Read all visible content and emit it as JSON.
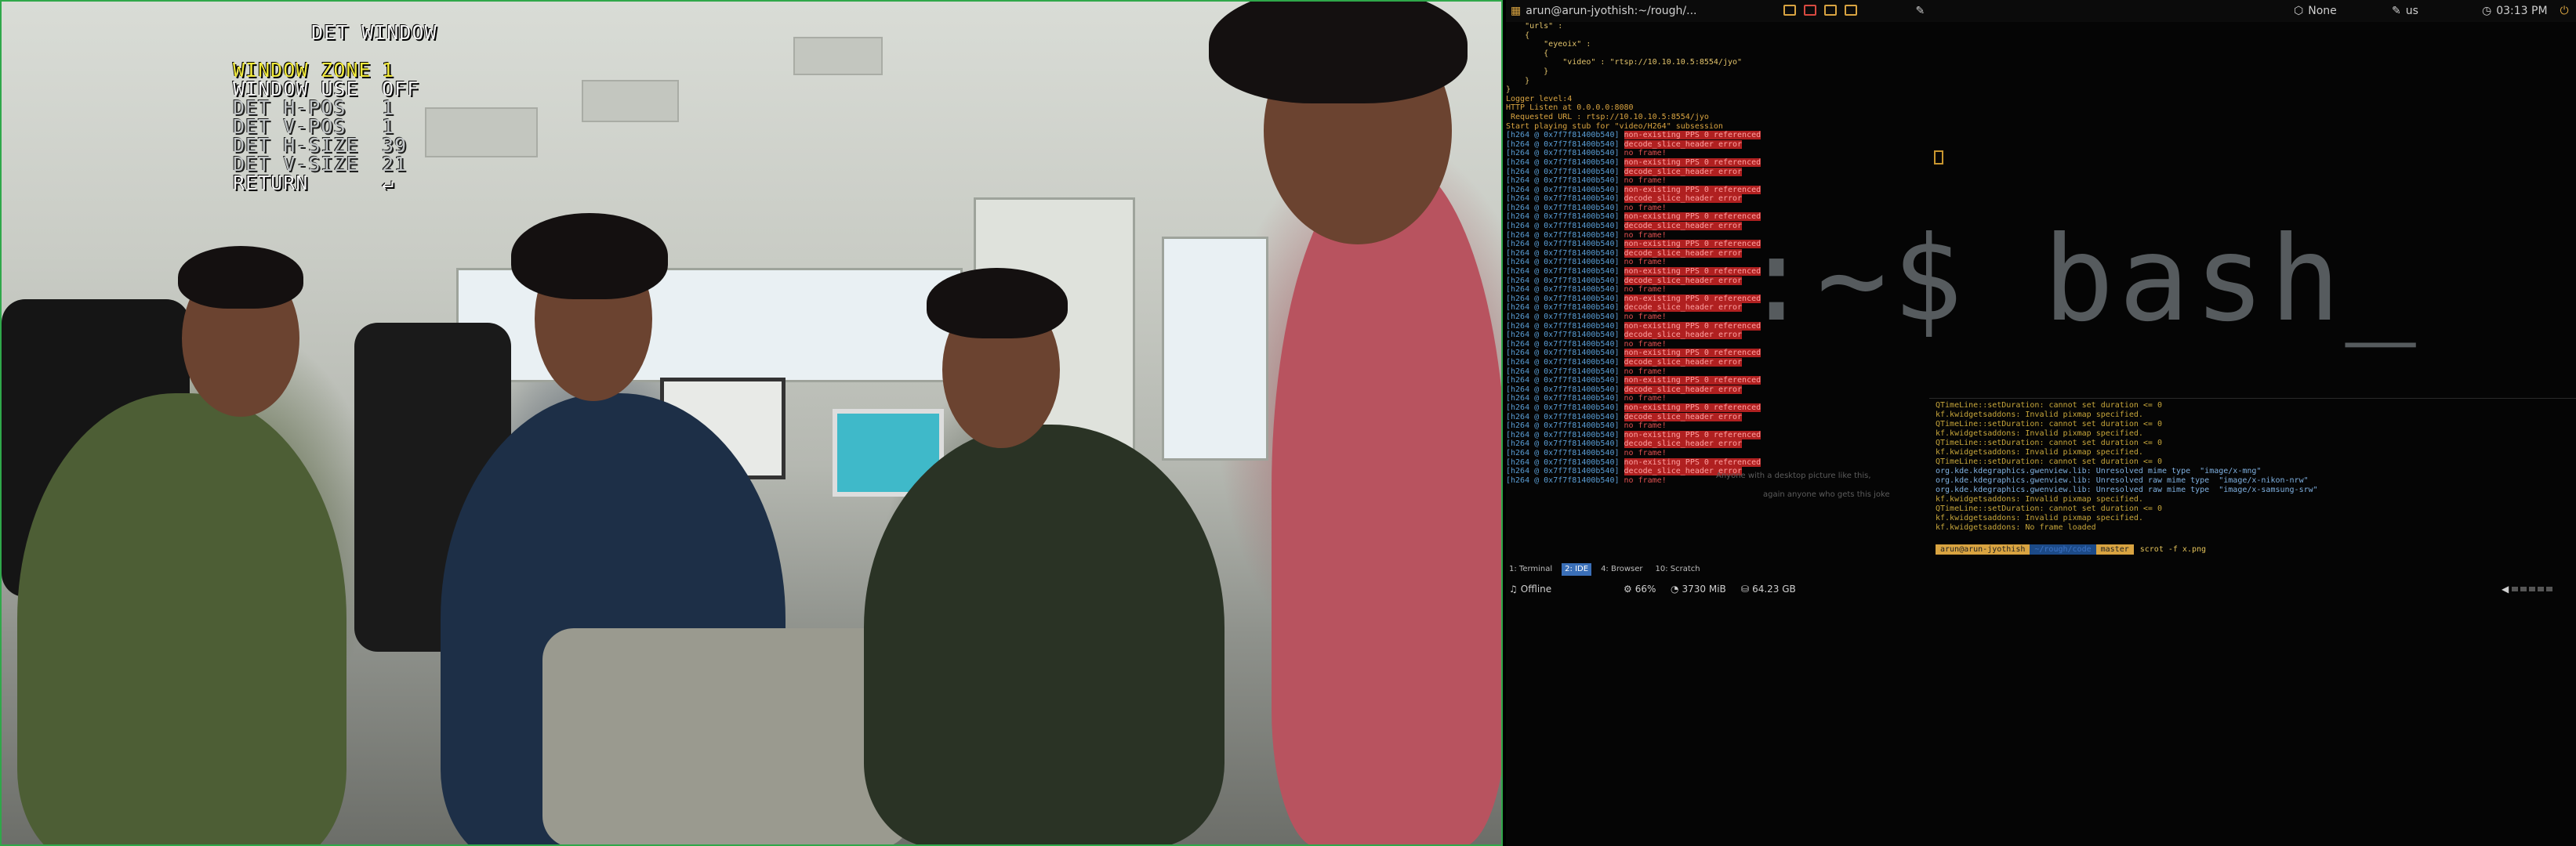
{
  "osd": {
    "title": "DET WINDOW",
    "rows": [
      {
        "label": "WINDOW ZONE",
        "value": "1"
      },
      {
        "label": "WINDOW USE",
        "value": "OFF"
      },
      {
        "label": "DET H-POS",
        "value": "1"
      },
      {
        "label": "DET V-POS",
        "value": "1"
      },
      {
        "label": "DET H-SIZE",
        "value": "39"
      },
      {
        "label": "DET V-SIZE",
        "value": "21"
      },
      {
        "label": "RETURN",
        "value": "↵"
      }
    ]
  },
  "topbar": {
    "window_title": "arun@arun-jyothish:~/rough/...",
    "network": "None",
    "keyboard": "us",
    "clock": "03:13 PM"
  },
  "terminal": {
    "config_lines": [
      "    \"urls\" :",
      "    {",
      "        \"eyeoix\" :",
      "        {",
      "            \"video\" : \"rtsp://10.10.10.5:8554/jyo\"",
      "        }",
      "    }",
      "}"
    ],
    "info_lines": [
      "Logger level:4",
      "HTTP Listen at 0.0.0.0:8080",
      " Requested URL : rtsp://10.10.10.5:8554/jyo",
      "Start playing stub for \"video/H264\" subsession"
    ],
    "h264_prefix": "[h264 @ 0x7f7f81400b540]",
    "error_messages": [
      "non-existing PPS 0 referenced",
      "decode_slice_header error",
      "no frame!"
    ],
    "h264_count": 39
  },
  "bash_logo": ":~$ bash_",
  "qtlog": [
    "QTimeLine::setDuration: cannot set duration <= 0",
    "kf.kwidgetsaddons: Invalid pixmap specified.",
    "QTimeLine::setDuration: cannot set duration <= 0",
    "kf.kwidgetsaddons: Invalid pixmap specified.",
    "QTimeLine::setDuration: cannot set duration <= 0",
    "kf.kwidgetsaddons: Invalid pixmap specified.",
    "QTimeLine::setDuration: cannot set duration <= 0",
    "org.kde.kdegraphics.gwenview.lib: Unresolved mime type  \"image/x-mng\"",
    "org.kde.kdegraphics.gwenview.lib: Unresolved raw mime type  \"image/x-nikon-nrw\"",
    "org.kde.kdegraphics.gwenview.lib: Unresolved raw mime type  \"image/x-samsung-srw\"",
    "kf.kwidgetsaddons: Invalid pixmap specified.",
    "QTimeLine::setDuration: cannot set duration <= 0",
    "kf.kwidgetsaddons: Invalid pixmap specified.",
    "kf.kwidgetsaddons: No frame loaded"
  ],
  "faint_text": [
    "Anyone with a desktop picture like this,",
    "again anyone who gets this joke"
  ],
  "prompt": {
    "user": "arun@arun-jyothish",
    "path": "~/rough/code",
    "branch": "master",
    "command": "scrot -f x.png"
  },
  "workspace_tabs": [
    {
      "label": "1: Terminal",
      "active": false
    },
    {
      "label": "2: IDE",
      "active": true
    },
    {
      "label": "4: Browser",
      "active": false
    },
    {
      "label": "10: Scratch",
      "active": false
    }
  ],
  "status": {
    "music": "Offline",
    "cpu": "66%",
    "memory": "3730 MiB",
    "disk": "64.23 GB"
  }
}
